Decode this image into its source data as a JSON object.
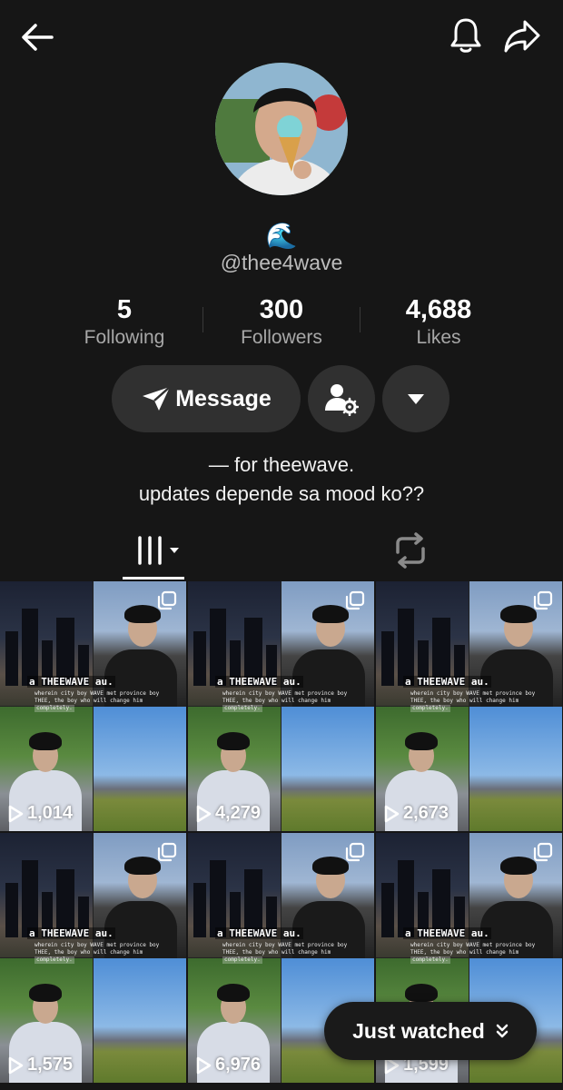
{
  "profile": {
    "emoji": "🌊",
    "handle": "@thee4wave",
    "bio_line1": "— for theewave.",
    "bio_line2": "updates depende sa mood ko??"
  },
  "stats": [
    {
      "value": "5",
      "label": "Following"
    },
    {
      "value": "300",
      "label": "Followers"
    },
    {
      "value": "4,688",
      "label": "Likes"
    }
  ],
  "actions": {
    "message_label": "Message"
  },
  "video_caption": {
    "title": "a THEEWAVE au.",
    "line1": "wherein city boy WAVE met province boy",
    "line2": "THEE, the boy who will change him",
    "line3": "completely."
  },
  "videos": [
    {
      "views": "1,014"
    },
    {
      "views": "4,279"
    },
    {
      "views": "2,673"
    },
    {
      "views": "1,575"
    },
    {
      "views": "6,976"
    },
    {
      "views": "1,599"
    }
  ],
  "floating": {
    "just_watched_label": "Just watched"
  },
  "colors": {
    "background": "#161616",
    "button_bg": "#303030",
    "muted_text": "#a8a8a8"
  },
  "icons": [
    "back-arrow-icon",
    "bell-icon",
    "share-icon",
    "send-icon",
    "person-gear-icon",
    "caret-down-icon",
    "grid-bars-icon",
    "repost-icon",
    "multi-image-icon",
    "play-icon",
    "double-chevron-down-icon"
  ]
}
